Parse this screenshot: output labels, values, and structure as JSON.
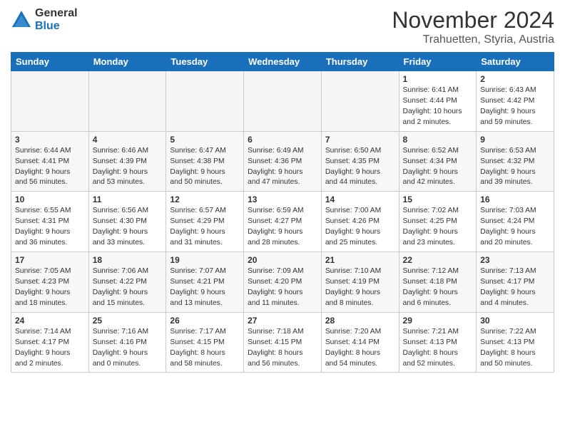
{
  "logo": {
    "general": "General",
    "blue": "Blue"
  },
  "header": {
    "title": "November 2024",
    "subtitle": "Trahuetten, Styria, Austria"
  },
  "weekdays": [
    "Sunday",
    "Monday",
    "Tuesday",
    "Wednesday",
    "Thursday",
    "Friday",
    "Saturday"
  ],
  "weeks": [
    [
      {
        "day": "",
        "info": ""
      },
      {
        "day": "",
        "info": ""
      },
      {
        "day": "",
        "info": ""
      },
      {
        "day": "",
        "info": ""
      },
      {
        "day": "",
        "info": ""
      },
      {
        "day": "1",
        "info": "Sunrise: 6:41 AM\nSunset: 4:44 PM\nDaylight: 10 hours\nand 2 minutes."
      },
      {
        "day": "2",
        "info": "Sunrise: 6:43 AM\nSunset: 4:42 PM\nDaylight: 9 hours\nand 59 minutes."
      }
    ],
    [
      {
        "day": "3",
        "info": "Sunrise: 6:44 AM\nSunset: 4:41 PM\nDaylight: 9 hours\nand 56 minutes."
      },
      {
        "day": "4",
        "info": "Sunrise: 6:46 AM\nSunset: 4:39 PM\nDaylight: 9 hours\nand 53 minutes."
      },
      {
        "day": "5",
        "info": "Sunrise: 6:47 AM\nSunset: 4:38 PM\nDaylight: 9 hours\nand 50 minutes."
      },
      {
        "day": "6",
        "info": "Sunrise: 6:49 AM\nSunset: 4:36 PM\nDaylight: 9 hours\nand 47 minutes."
      },
      {
        "day": "7",
        "info": "Sunrise: 6:50 AM\nSunset: 4:35 PM\nDaylight: 9 hours\nand 44 minutes."
      },
      {
        "day": "8",
        "info": "Sunrise: 6:52 AM\nSunset: 4:34 PM\nDaylight: 9 hours\nand 42 minutes."
      },
      {
        "day": "9",
        "info": "Sunrise: 6:53 AM\nSunset: 4:32 PM\nDaylight: 9 hours\nand 39 minutes."
      }
    ],
    [
      {
        "day": "10",
        "info": "Sunrise: 6:55 AM\nSunset: 4:31 PM\nDaylight: 9 hours\nand 36 minutes."
      },
      {
        "day": "11",
        "info": "Sunrise: 6:56 AM\nSunset: 4:30 PM\nDaylight: 9 hours\nand 33 minutes."
      },
      {
        "day": "12",
        "info": "Sunrise: 6:57 AM\nSunset: 4:29 PM\nDaylight: 9 hours\nand 31 minutes."
      },
      {
        "day": "13",
        "info": "Sunrise: 6:59 AM\nSunset: 4:27 PM\nDaylight: 9 hours\nand 28 minutes."
      },
      {
        "day": "14",
        "info": "Sunrise: 7:00 AM\nSunset: 4:26 PM\nDaylight: 9 hours\nand 25 minutes."
      },
      {
        "day": "15",
        "info": "Sunrise: 7:02 AM\nSunset: 4:25 PM\nDaylight: 9 hours\nand 23 minutes."
      },
      {
        "day": "16",
        "info": "Sunrise: 7:03 AM\nSunset: 4:24 PM\nDaylight: 9 hours\nand 20 minutes."
      }
    ],
    [
      {
        "day": "17",
        "info": "Sunrise: 7:05 AM\nSunset: 4:23 PM\nDaylight: 9 hours\nand 18 minutes."
      },
      {
        "day": "18",
        "info": "Sunrise: 7:06 AM\nSunset: 4:22 PM\nDaylight: 9 hours\nand 15 minutes."
      },
      {
        "day": "19",
        "info": "Sunrise: 7:07 AM\nSunset: 4:21 PM\nDaylight: 9 hours\nand 13 minutes."
      },
      {
        "day": "20",
        "info": "Sunrise: 7:09 AM\nSunset: 4:20 PM\nDaylight: 9 hours\nand 11 minutes."
      },
      {
        "day": "21",
        "info": "Sunrise: 7:10 AM\nSunset: 4:19 PM\nDaylight: 9 hours\nand 8 minutes."
      },
      {
        "day": "22",
        "info": "Sunrise: 7:12 AM\nSunset: 4:18 PM\nDaylight: 9 hours\nand 6 minutes."
      },
      {
        "day": "23",
        "info": "Sunrise: 7:13 AM\nSunset: 4:17 PM\nDaylight: 9 hours\nand 4 minutes."
      }
    ],
    [
      {
        "day": "24",
        "info": "Sunrise: 7:14 AM\nSunset: 4:17 PM\nDaylight: 9 hours\nand 2 minutes."
      },
      {
        "day": "25",
        "info": "Sunrise: 7:16 AM\nSunset: 4:16 PM\nDaylight: 9 hours\nand 0 minutes."
      },
      {
        "day": "26",
        "info": "Sunrise: 7:17 AM\nSunset: 4:15 PM\nDaylight: 8 hours\nand 58 minutes."
      },
      {
        "day": "27",
        "info": "Sunrise: 7:18 AM\nSunset: 4:15 PM\nDaylight: 8 hours\nand 56 minutes."
      },
      {
        "day": "28",
        "info": "Sunrise: 7:20 AM\nSunset: 4:14 PM\nDaylight: 8 hours\nand 54 minutes."
      },
      {
        "day": "29",
        "info": "Sunrise: 7:21 AM\nSunset: 4:13 PM\nDaylight: 8 hours\nand 52 minutes."
      },
      {
        "day": "30",
        "info": "Sunrise: 7:22 AM\nSunset: 4:13 PM\nDaylight: 8 hours\nand 50 minutes."
      }
    ]
  ]
}
